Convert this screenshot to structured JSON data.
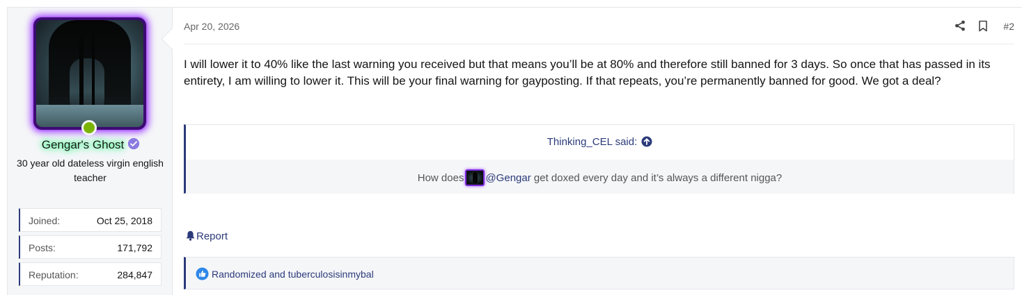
{
  "user": {
    "name": "Gengar's Ghost",
    "title": "30 year old dateless virgin english teacher",
    "stats": [
      {
        "label": "Joined:",
        "value": "Oct 25, 2018"
      },
      {
        "label": "Posts:",
        "value": "171,792"
      },
      {
        "label": "Reputation:",
        "value": "284,847"
      }
    ],
    "online": true,
    "verified_icon": "verified-check-icon"
  },
  "post": {
    "date": "Apr 20, 2026",
    "number": "#2",
    "body": "I will lower it to 40% like the last warning you received but that means you’ll be at 80% and therefore still banned for 3 days. So once that has passed in its entirety, I am willing to lower it. This will be your final warning for gayposting. If that repeats, you’re permanently banned for good. We got a deal?",
    "quote": {
      "author_said": "Thinking_CEL said:",
      "text_before": "How does",
      "mention": "@Gengar",
      "text_after": "get doxed every day and it’s always a different nigga?"
    },
    "report_label": "Report",
    "reactions_text": "Randomized and tuberculosisinmybal"
  },
  "colors": {
    "accent": "#2b3a7a",
    "online": "#7bb400",
    "avatar_glow": "#a64dff",
    "name_glow": "#5cff9d",
    "verified": "#8b7be0"
  }
}
